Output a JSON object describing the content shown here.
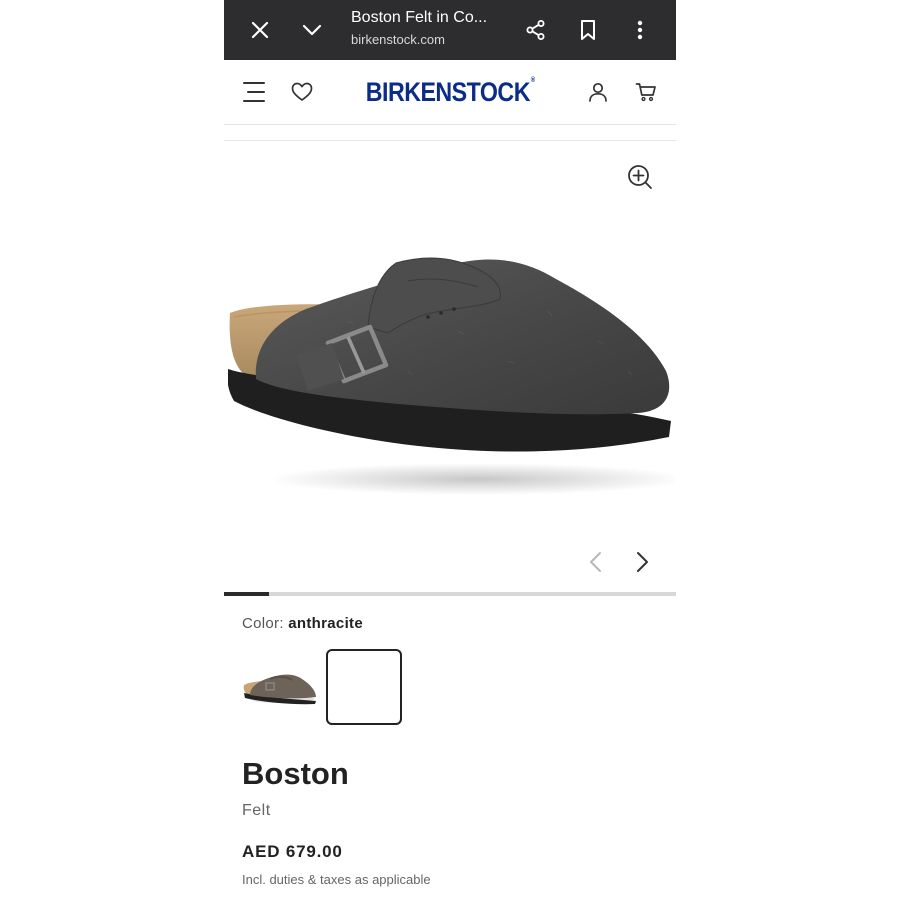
{
  "browser": {
    "title": "Boston Felt in Co...",
    "url": "birkenstock.com",
    "icons": [
      "close-icon",
      "chevron-down-icon",
      "share-icon",
      "bookmark-icon",
      "more-vert-icon"
    ],
    "bar_color": "#2d2d2f"
  },
  "header": {
    "logo": "BIRKENSTOCK",
    "logo_mark": "®",
    "logo_color": "#0b2d87",
    "icons": [
      "menu-icon",
      "heart-icon",
      "account-icon",
      "cart-icon"
    ]
  },
  "gallery": {
    "progress": 0.1,
    "icons": [
      "zoom-in-icon",
      "chevron-left-icon",
      "chevron-right-icon"
    ]
  },
  "color": {
    "label": "Color:",
    "value": "anthracite"
  },
  "product": {
    "name": "Boston",
    "material": "Felt",
    "price": "AED 679.00",
    "tax_note": "Incl. duties & taxes as applicable"
  }
}
